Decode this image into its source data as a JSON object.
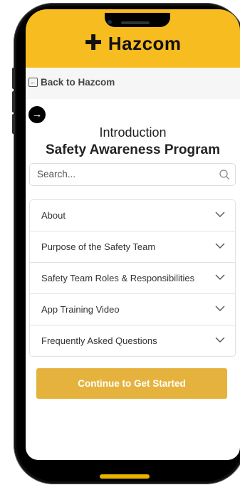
{
  "header": {
    "logo_text": "Hazcom",
    "logo_symbol": "✚",
    "bg_color": "#f7bc1f"
  },
  "nav": {
    "back_label": "Back to Hazcom"
  },
  "intro": {
    "subtitle": "Introduction",
    "title": "Safety Awareness Program"
  },
  "search": {
    "placeholder": "Search..."
  },
  "accordion": {
    "items": [
      {
        "label": "About"
      },
      {
        "label": "Purpose of the Safety Team"
      },
      {
        "label": "Safety Team Roles & Responsibilities"
      },
      {
        "label": "App Training Video"
      },
      {
        "label": "Frequently Asked Questions"
      }
    ]
  },
  "cta": {
    "label": "Continue to Get Started",
    "color": "#e5b33d"
  }
}
